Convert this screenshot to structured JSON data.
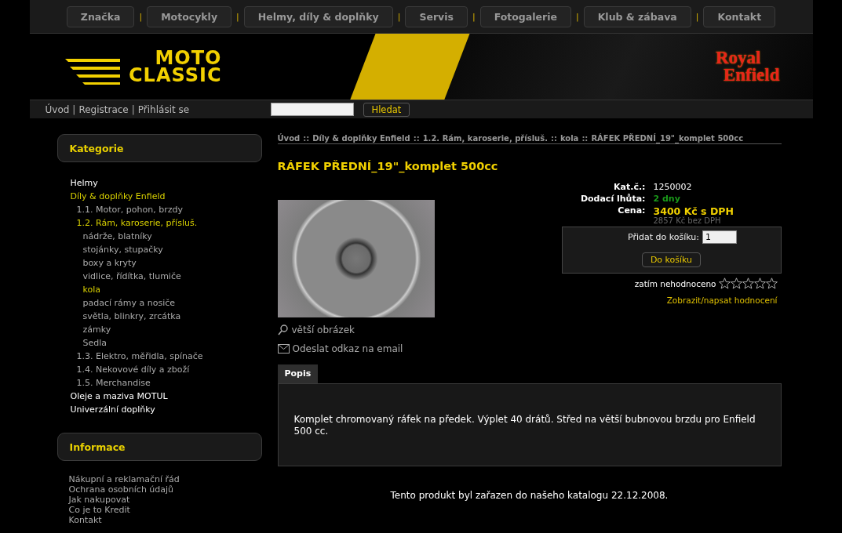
{
  "top_nav": {
    "separator": "|",
    "items": [
      {
        "label": "Značka"
      },
      {
        "label": "Motocykly"
      },
      {
        "label": "Helmy, díly & doplňky"
      },
      {
        "label": "Servis"
      },
      {
        "label": "Fotogalerie"
      },
      {
        "label": "Klub & zábava"
      },
      {
        "label": "Kontakt"
      }
    ]
  },
  "logo": {
    "line_1": "MOTO",
    "line_2": "CLASSIC"
  },
  "brand_logo": {
    "line_1": "Royal",
    "line_2": "Enfield"
  },
  "user_links": {
    "separator": "|",
    "items": [
      "Úvod",
      "Registrace",
      "Přihlásit se"
    ]
  },
  "search": {
    "button": "Hledat"
  },
  "categories": {
    "title": "Kategorie",
    "items": [
      {
        "label": "Helmy",
        "selected": false
      },
      {
        "label": "Díly & doplňky Enfield",
        "selected": true,
        "children": [
          {
            "label": "1.1. Motor, pohon, brzdy",
            "selected": false
          },
          {
            "label": "1.2. Rám, karoserie, přísluš.",
            "selected": true,
            "children": [
              {
                "label": "nádrže, blatníky",
                "selected": false
              },
              {
                "label": "stojánky, stupačky",
                "selected": false
              },
              {
                "label": "boxy a kryty",
                "selected": false
              },
              {
                "label": "vidlice, řídítka, tlumiče",
                "selected": false
              },
              {
                "label": "kola",
                "selected": true
              },
              {
                "label": "padací rámy a nosiče",
                "selected": false
              },
              {
                "label": "světla, blinkry, zrcátka",
                "selected": false
              },
              {
                "label": "zámky",
                "selected": false
              },
              {
                "label": "Sedla",
                "selected": false
              }
            ]
          },
          {
            "label": "1.3. Elektro, měřidla, spínače",
            "selected": false
          },
          {
            "label": "1.4. Nekovové díly a zboží",
            "selected": false
          },
          {
            "label": "1.5. Merchandise",
            "selected": false
          }
        ]
      },
      {
        "label": "Oleje a maziva MOTUL",
        "selected": false
      },
      {
        "label": "Univerzální doplňky",
        "selected": false
      }
    ]
  },
  "information": {
    "title": "Informace",
    "items": [
      "Nákupní a reklamační řád",
      "Ochrana osobních údajů",
      "Jak nakupovat",
      "Co je to Kredit",
      "Kontakt"
    ]
  },
  "breadcrumb": {
    "separator": "::",
    "items": [
      "Úvod",
      "Díly & doplňky Enfield",
      "1.2. Rám, karoserie, přísluš.",
      "kola",
      "RÁFEK PŘEDNÍ_19\"_komplet 500cc"
    ]
  },
  "product": {
    "title": "RÁFEK PŘEDNÍ_19\"_komplet 500cc",
    "details": [
      {
        "label": "Kat.č.:",
        "value": "1250002",
        "kind": "plain"
      },
      {
        "label": "Dodací lhůta:",
        "value": "2 dny",
        "kind": "delivery"
      },
      {
        "label": "Cena:",
        "value": "3400 Kč s DPH",
        "kind": "price",
        "note": "2857 Kč bez DPH"
      }
    ],
    "cart": {
      "label": "Přidat do košíku:",
      "quantity": "1",
      "button": "Do košíku"
    },
    "rating": {
      "text": "zatím nehodnoceno",
      "stars": 0
    },
    "rating_link": "Zobrazit/napsat hodnocení",
    "links": [
      {
        "label": "větší obrázek",
        "kind": "zoom"
      },
      {
        "label": "Odeslat odkaz na email",
        "kind": "email"
      }
    ],
    "tabs": [
      {
        "label": "Popis",
        "selected": true
      }
    ],
    "description": "Komplet chromovaný ráfek na předek. Výplet 40 drátů. Střed na větší bubnovou brzdu pro Enfield 500 cc.",
    "footer_note": "Tento produkt byl zařazen do našeho katalogu 22.12.2008."
  }
}
